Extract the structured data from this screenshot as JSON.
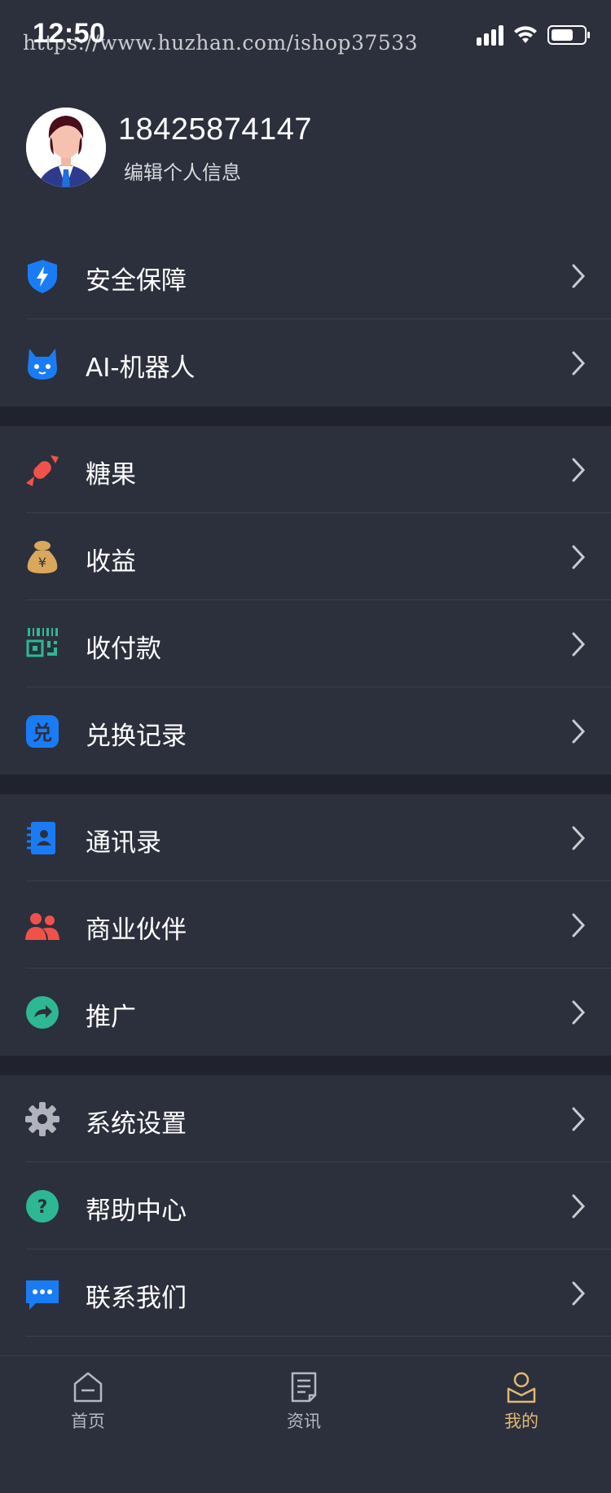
{
  "status_bar": {
    "time": "12:50",
    "watermark": "https://www.huzhan.com/ishop37533"
  },
  "profile": {
    "phone": "18425874147",
    "edit_label": "编辑个人信息"
  },
  "menu": {
    "groups": [
      {
        "items": [
          {
            "label": "安全保障",
            "icon": "shield-bolt-icon",
            "color": "#1a7cf5"
          },
          {
            "label": "AI-机器人",
            "icon": "robot-cat-icon",
            "color": "#1a7cf5"
          }
        ]
      },
      {
        "items": [
          {
            "label": "糖果",
            "icon": "candy-icon",
            "color": "#f0524a"
          },
          {
            "label": "收益",
            "icon": "money-bag-icon",
            "color": "#d9a85c"
          },
          {
            "label": "收付款",
            "icon": "qr-code-icon",
            "color": "#2db893"
          },
          {
            "label": "兑换记录",
            "icon": "exchange-icon",
            "color": "#1a7cf5"
          }
        ]
      },
      {
        "items": [
          {
            "label": "通讯录",
            "icon": "contacts-book-icon",
            "color": "#1a7cf5"
          },
          {
            "label": "商业伙伴",
            "icon": "partners-icon",
            "color": "#f0524a"
          },
          {
            "label": "推广",
            "icon": "share-arrow-icon",
            "color": "#2db893"
          }
        ]
      },
      {
        "items": [
          {
            "label": "系统设置",
            "icon": "gear-icon",
            "color": "#b0b3bb"
          },
          {
            "label": "帮助中心",
            "icon": "help-icon",
            "color": "#2db893"
          },
          {
            "label": "联系我们",
            "icon": "chat-bubble-icon",
            "color": "#1a7cf5"
          }
        ]
      }
    ]
  },
  "tabbar": {
    "tabs": [
      {
        "label": "首页",
        "icon": "home-icon",
        "active": false
      },
      {
        "label": "资讯",
        "icon": "news-icon",
        "active": false
      },
      {
        "label": "我的",
        "icon": "profile-icon",
        "active": true
      }
    ],
    "active_color": "#e0b877",
    "inactive_color": "#b4b8c2"
  }
}
